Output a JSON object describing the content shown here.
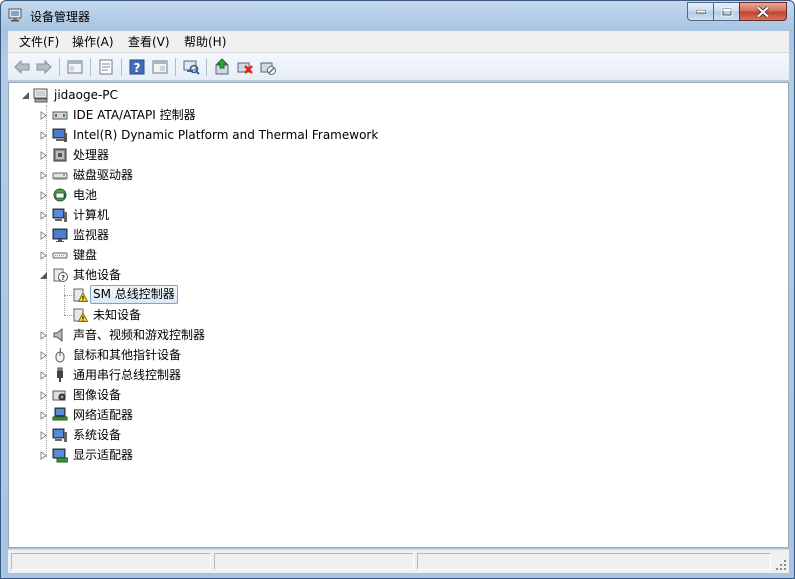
{
  "window": {
    "title": "设备管理器"
  },
  "menu": [
    {
      "label": "文件(F)"
    },
    {
      "label": "操作(A)"
    },
    {
      "label": "查看(V)"
    },
    {
      "label": "帮助(H)"
    }
  ],
  "toolbar": {
    "buttons": [
      "back-icon",
      "forward-icon",
      "show-hide-tree-icon",
      "properties-icon",
      "help-icon",
      "view-icon",
      "scan-hardware-icon",
      "update-driver-icon",
      "uninstall-icon",
      "disable-icon"
    ]
  },
  "tree": {
    "root": "jidaoge-PC",
    "categories": [
      {
        "label": "IDE ATA/ATAPI 控制器",
        "icon": "ide-controller-icon"
      },
      {
        "label": "Intel(R) Dynamic Platform and Thermal Framework",
        "icon": "computer-device-icon"
      },
      {
        "label": "处理器",
        "icon": "processor-icon"
      },
      {
        "label": "磁盘驱动器",
        "icon": "disk-drive-icon"
      },
      {
        "label": "电池",
        "icon": "battery-icon"
      },
      {
        "label": "计算机",
        "icon": "computer-icon"
      },
      {
        "label": "监视器",
        "icon": "monitor-icon"
      },
      {
        "label": "键盘",
        "icon": "keyboard-icon"
      },
      {
        "label": "其他设备",
        "icon": "other-devices-icon",
        "expanded": true,
        "children": [
          {
            "label": "SM 总线控制器",
            "icon": "warning-device-icon",
            "selected": true
          },
          {
            "label": "未知设备",
            "icon": "warning-device-icon"
          }
        ]
      },
      {
        "label": "声音、视频和游戏控制器",
        "icon": "speaker-icon"
      },
      {
        "label": "鼠标和其他指针设备",
        "icon": "mouse-icon"
      },
      {
        "label": "通用串行总线控制器",
        "icon": "usb-icon"
      },
      {
        "label": "图像设备",
        "icon": "camera-icon"
      },
      {
        "label": "网络适配器",
        "icon": "network-adapter-icon"
      },
      {
        "label": "系统设备",
        "icon": "system-device-icon"
      },
      {
        "label": "显示适配器",
        "icon": "display-adapter-icon"
      }
    ]
  }
}
